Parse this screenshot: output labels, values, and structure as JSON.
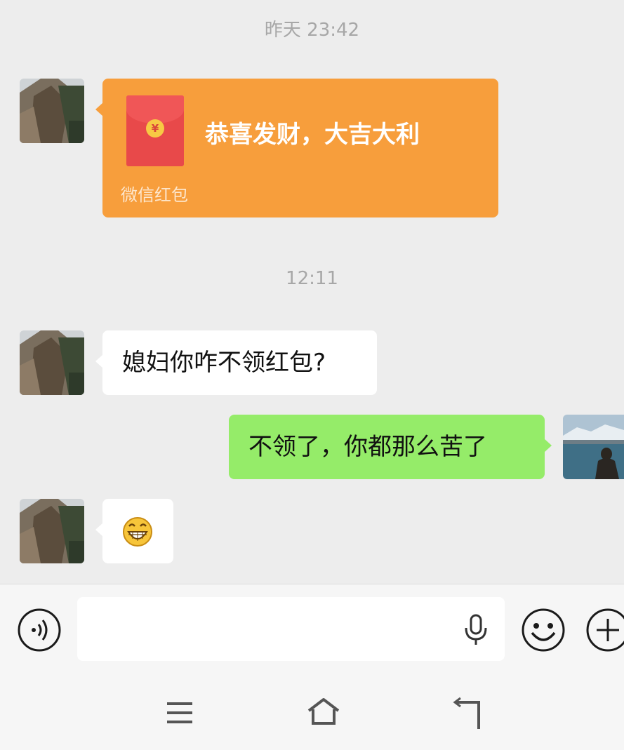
{
  "timestamps": {
    "first": "昨天 23:42",
    "second": "12:11"
  },
  "messages": {
    "red_packet": {
      "title": "恭喜发财，大吉大利",
      "label": "微信红包",
      "currency_symbol": "¥"
    },
    "incoming_text": "媳妇你咋不领红包?",
    "outgoing_text": "不领了，你都那么苦了",
    "incoming_emoji": "grinning-face"
  },
  "input_bar": {
    "voice_icon": "voice-icon",
    "mic_icon": "microphone-icon",
    "emoji_icon": "emoji-icon",
    "plus_icon": "plus-icon",
    "text_value": ""
  },
  "nav_bar": {
    "menu_icon": "menu-icon",
    "home_icon": "home-icon",
    "back_icon": "back-icon"
  },
  "colors": {
    "background": "#ededed",
    "outgoing_bubble": "#95ec69",
    "red_packet": "#f79e3c",
    "envelope": "#e8494a"
  }
}
